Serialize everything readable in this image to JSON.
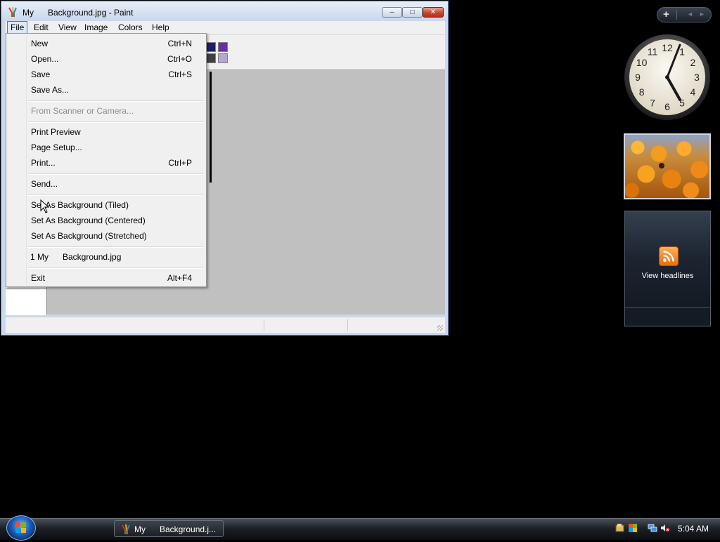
{
  "window": {
    "title": "My      Background.jpg - Paint",
    "minimize": "–",
    "maximize": "□",
    "close": "✕"
  },
  "menubar": [
    "File",
    "Edit",
    "View",
    "Image",
    "Colors",
    "Help"
  ],
  "file_menu": {
    "items": [
      {
        "label": "New",
        "accel": "Ctrl+N"
      },
      {
        "label": "Open...",
        "accel": "Ctrl+O"
      },
      {
        "label": "Save",
        "accel": "Ctrl+S"
      },
      {
        "label": "Save As...",
        "accel": ""
      },
      {
        "label": "From Scanner or Camera...",
        "accel": ""
      },
      {
        "label": "Print Preview",
        "accel": ""
      },
      {
        "label": "Page Setup...",
        "accel": ""
      },
      {
        "label": "Print...",
        "accel": "Ctrl+P"
      },
      {
        "label": "Send...",
        "accel": ""
      },
      {
        "label": "Set As Background (Tiled)",
        "accel": ""
      },
      {
        "label": "Set As Background (Centered)",
        "accel": ""
      },
      {
        "label": "Set As Background (Stretched)",
        "accel": ""
      },
      {
        "label": "1 My      Background.jpg",
        "accel": ""
      },
      {
        "label": "Exit",
        "accel": "Alt+F4"
      }
    ]
  },
  "palette_colors": [
    "#1e1e6e",
    "#6a2ea6",
    "#404040",
    "#b7a7cf"
  ],
  "sidebar": {
    "add_gadget": "+",
    "prev": "◄",
    "next": "►",
    "feed_label": "View headlines"
  },
  "clock": {
    "numbers": [
      "12",
      "1",
      "2",
      "3",
      "4",
      "5",
      "6",
      "7",
      "8",
      "9",
      "10",
      "11"
    ]
  },
  "taskbar": {
    "task_label": "My      Background.j...",
    "time": "5:04 AM"
  }
}
